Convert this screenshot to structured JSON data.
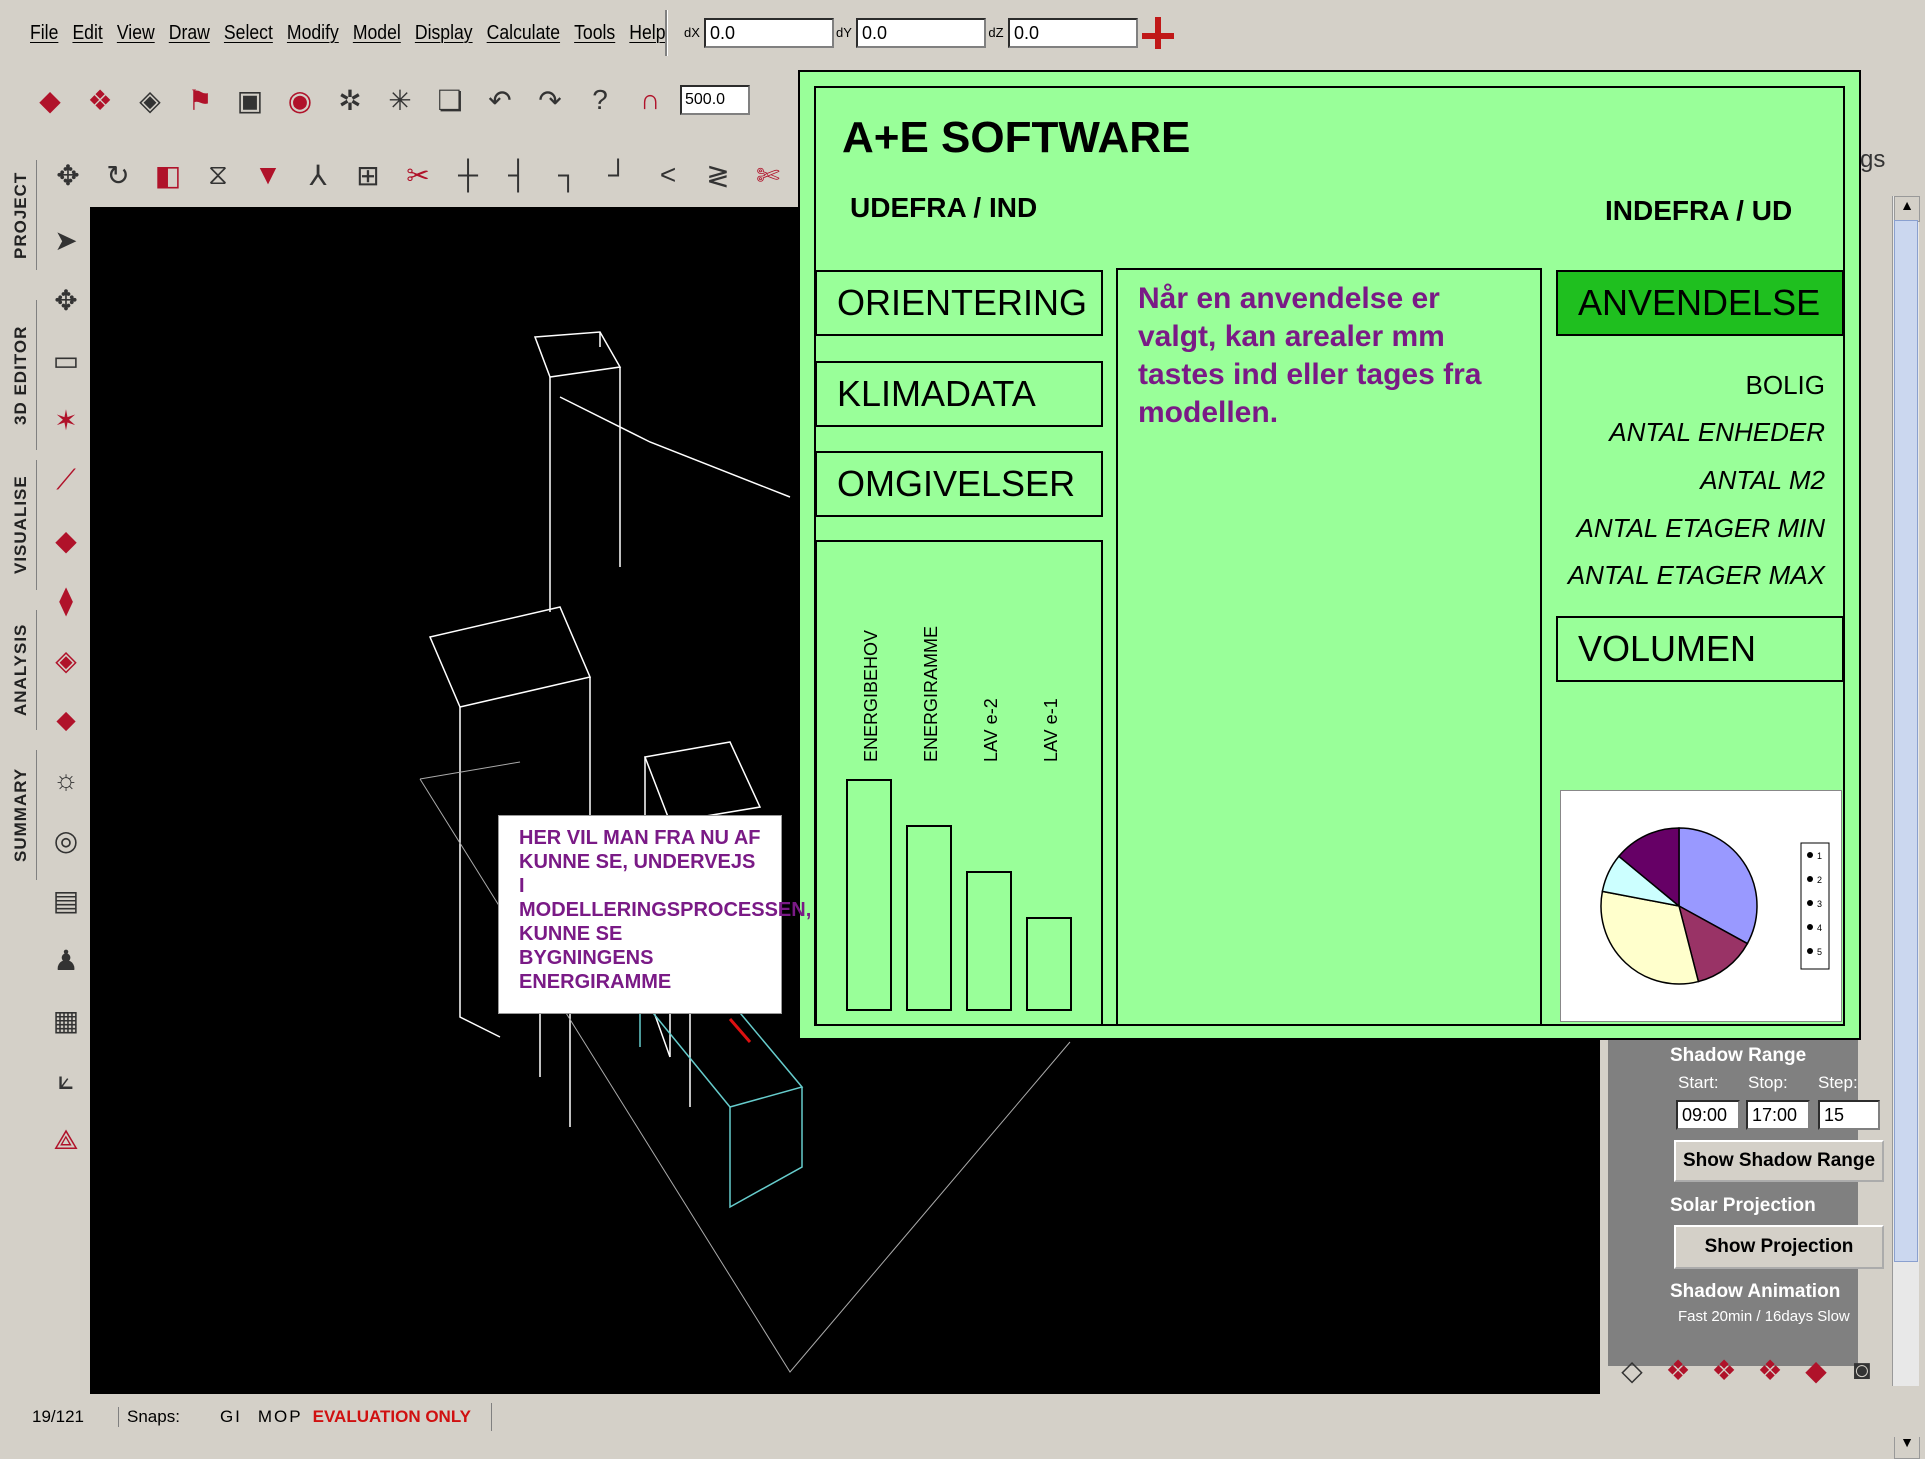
{
  "menubar": {
    "items": [
      "File",
      "Edit",
      "View",
      "Draw",
      "Select",
      "Modify",
      "Model",
      "Display",
      "Calculate",
      "Tools",
      "Help"
    ]
  },
  "coords": {
    "dx_label": "dX",
    "dx_value": "0.0",
    "dy_label": "dY",
    "dy_value": "0.0",
    "dz_label": "dZ",
    "dz_value": "0.0",
    "grid_value": "500.0"
  },
  "left_tabs": [
    "PROJECT",
    "3D EDITOR",
    "VISUALISE",
    "ANALYSIS",
    "SUMMARY"
  ],
  "right_panel": {
    "partial_title": "gs",
    "shadow_range": {
      "title": "Shadow Range",
      "start_label": "Start:",
      "stop_label": "Stop:",
      "step_label": "Step:",
      "start": "09:00",
      "stop": "17:00",
      "step": "15",
      "button": "Show Shadow Range"
    },
    "solar_projection": {
      "title": "Solar Projection",
      "button": "Show Projection"
    },
    "shadow_animation": {
      "title": "Shadow Animation",
      "info": "Fast   20min / 16days   Slow"
    }
  },
  "statusbar": {
    "position": "19/121",
    "snaps_label": "Snaps:",
    "snaps_on": "GI",
    "snaps_rest": "MOP",
    "evaluation": "EVALUATION ONLY"
  },
  "overlay": {
    "title": "A+E SOFTWARE",
    "left_sub": "UDEFRA / IND",
    "right_sub": "INDEFRA / UD",
    "nav": [
      "ORIENTERING",
      "KLIMADATA",
      "OMGIVELSER"
    ],
    "description": "Når en anvendelse er valgt, kan arealer mm tastes ind eller tages fra modellen.",
    "active_button": "ANVENDELSE",
    "usage_items": [
      "BOLIG",
      "ANTAL ENHEDER",
      "ANTAL M2",
      "ANTAL ETAGER MIN",
      "ANTAL ETAGER MAX"
    ],
    "volume_button": "VOLUMEN",
    "accent_green": "#1fbf1f",
    "panel_green": "#99ff99",
    "text_purple": "#7a1a86"
  },
  "note": "HER VIL MAN FRA NU AF KUNNE SE, UNDERVEJS I MODELLERINGSPROCESSEN, KUNNE SE BYGNINGENS ENERGIRAMME",
  "chart_data": [
    {
      "type": "bar",
      "categories": [
        "ENERGIBEHOV",
        "ENERGIRAMME",
        "LAV e-2",
        "LAV e-1"
      ],
      "values": [
        100,
        80,
        60,
        40
      ],
      "title": "",
      "xlabel": "",
      "ylabel": ""
    },
    {
      "type": "pie",
      "categories": [
        "1",
        "2",
        "3",
        "4",
        "5"
      ],
      "values": [
        33,
        13,
        32,
        8,
        14
      ],
      "colors": [
        "#9999ff",
        "#993366",
        "#ffffcc",
        "#ccffff",
        "#660066"
      ]
    }
  ]
}
